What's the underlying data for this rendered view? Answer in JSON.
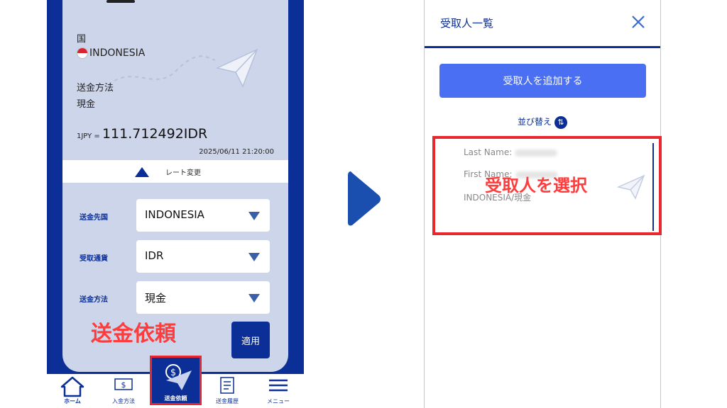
{
  "left_screen": {
    "country_label": "国",
    "country_value": "INDONESIA",
    "method_label": "送金方法",
    "method_value": "現金",
    "rate_prefix": "1JPY = ",
    "rate_value": "111.712492IDR",
    "rate_timestamp": "2025/06/11 21:20:00",
    "rate_change_label": "レート変更",
    "form": {
      "destination_label": "送金先国",
      "destination_value": "INDONESIA",
      "currency_label": "受取通貨",
      "currency_value": "IDR",
      "method_label": "送金方法",
      "method_value": "現金",
      "apply_label": "適用"
    },
    "overlay_text": "送金依頼",
    "nav": [
      {
        "label": "ホーム",
        "icon": "home-icon"
      },
      {
        "label": "入金方法",
        "icon": "deposit-icon"
      },
      {
        "label": "送金依頼",
        "icon": "send-icon",
        "active": true
      },
      {
        "label": "送金履歴",
        "icon": "history-icon"
      },
      {
        "label": "メニュー",
        "icon": "menu-icon"
      }
    ]
  },
  "right_screen": {
    "title": "受取人一覧",
    "add_button": "受取人を追加する",
    "sort_label": "並び替え",
    "recipient": {
      "last_name_label": "Last Name:",
      "first_name_label": "First Name:",
      "country_method": "INDONESIA/現金"
    },
    "overlay_text": "受取人を選択"
  },
  "colors": {
    "brand_navy": "#0b2f96",
    "card_bg": "#cdd5ea",
    "accent_blue": "#4a6ff2",
    "highlight_red": "#e8282f"
  }
}
